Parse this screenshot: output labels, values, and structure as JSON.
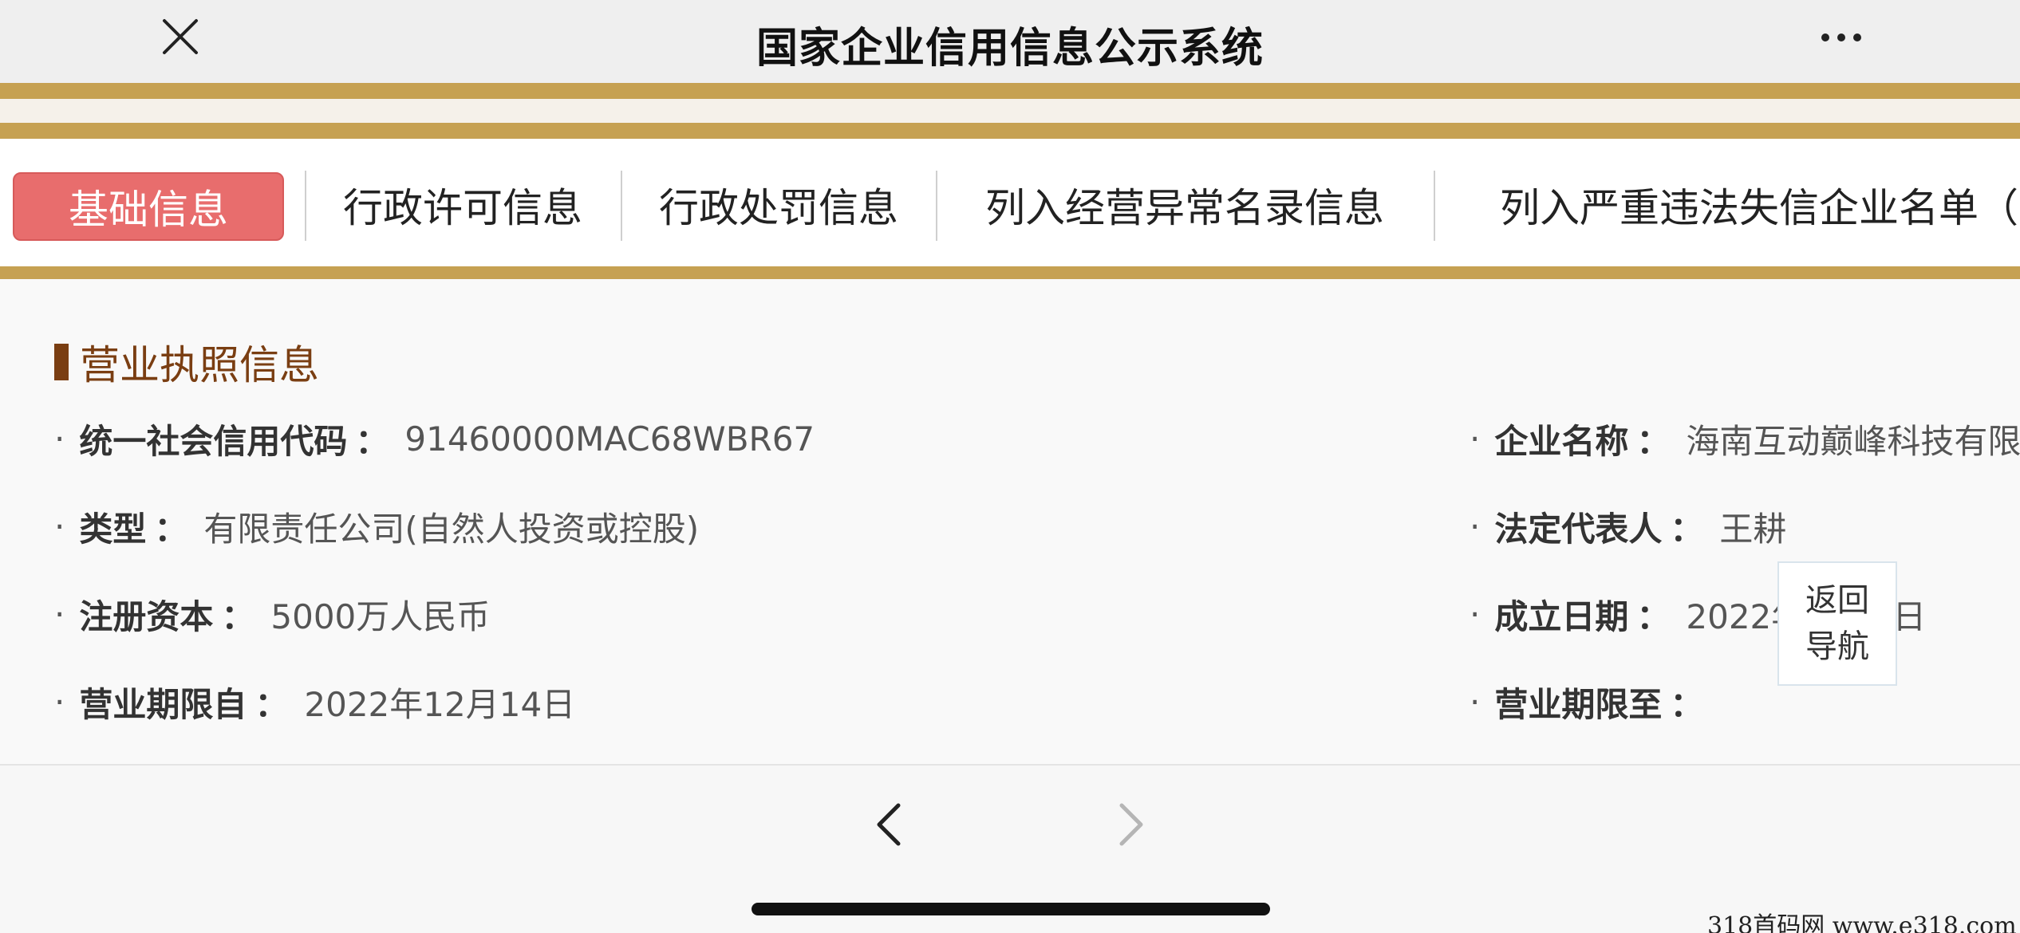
{
  "topbar": {
    "title": "国家企业信用信息公示系统",
    "close_icon": "close-icon",
    "more_icon": "more-horizontal-icon"
  },
  "tabs": [
    {
      "label": "基础信息",
      "active": true
    },
    {
      "label": "行政许可信息",
      "active": false
    },
    {
      "label": "行政处罚信息",
      "active": false
    },
    {
      "label": "列入经营异常名录信息",
      "active": false
    },
    {
      "label": "列入严重违法失信企业名单（黑",
      "active": false
    }
  ],
  "section": {
    "title": "营业执照信息"
  },
  "fields": {
    "credit_code": {
      "label": "统一社会信用代码",
      "value": "91460000MAC68WBR67"
    },
    "company_name": {
      "label": "企业名称",
      "value": "海南互动巅峰科技有限公"
    },
    "type": {
      "label": "类型",
      "value": "有限责任公司(自然人投资或控股)"
    },
    "legal_rep": {
      "label": "法定代表人",
      "value": "王耕"
    },
    "capital": {
      "label": "注册资本",
      "value": "5000万人民币"
    },
    "founded": {
      "label": "成立日期",
      "value_prefix": "2022年",
      "value_suffix": "日"
    },
    "term_from": {
      "label": "营业期限自",
      "value": "2022年12月14日"
    },
    "term_to": {
      "label": "营业期限至",
      "value": ""
    }
  },
  "float_nav": {
    "line1": "返回",
    "line2": "导航"
  },
  "bottom_nav": {
    "back_icon": "chevron-left-icon",
    "forward_icon": "chevron-right-icon"
  },
  "watermark": "318首码网  www.e318.com",
  "colors": {
    "gold": "#c6a152",
    "active_tab": "#e86d6d",
    "section_brown": "#7a3e12"
  }
}
